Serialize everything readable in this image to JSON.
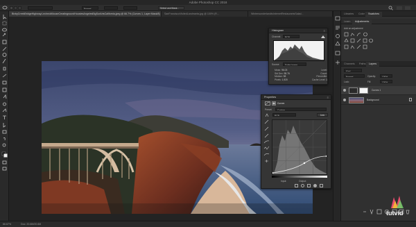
{
  "app": {
    "title": "Adobe Photoshop CC 2018"
  },
  "options_bar": {
    "mode_label": "Normal",
    "select_mask": "Select and Mask..."
  },
  "tabs": [
    {
      "label": "BixbyCreekBridgeHighway.LecheckMouseCreatingroundHoustesAngelesBigSurArtsCalifornia.jpeg @ 66.7% (Curves 1, Layer Mask/8)",
      "active": true
    },
    {
      "label": "SanFranciscoVisitedLandmarks.jpg @ 100% (R...",
      "active": false
    },
    {
      "label": "WinterwonderlandtsInternetRestaurantsSalad...",
      "active": false
    }
  ],
  "status": {
    "zoom": "66.67%",
    "doc": "Doc: 20.6M/20.6M"
  },
  "histogram": {
    "title": "Histogram",
    "channel_label": "Channel:",
    "channel_value": "RGB",
    "source_label": "Source:",
    "source_value": "Entire Image",
    "stats_left": [
      [
        "Mean:",
        "96.03"
      ],
      [
        "Std Dev:",
        "55.76"
      ],
      [
        "Median:",
        "98"
      ],
      [
        "Pixels:",
        "1,920"
      ]
    ],
    "stats_right": [
      [
        "Level:",
        ""
      ],
      [
        "Count:",
        ""
      ],
      [
        "Percentile:",
        ""
      ],
      [
        "Cache Level:",
        "1"
      ]
    ]
  },
  "properties": {
    "title": "Properties",
    "kind": "Curves",
    "preset_label": "Preset:",
    "preset_value": "Custom",
    "channel_value": "RGB",
    "auto_label": "Auto",
    "input_label": "Input:",
    "output_label": "Output:"
  },
  "right_panel": {
    "top_tabs": [
      "Libraries",
      "Color",
      "Swatches"
    ],
    "sub_tabs": [
      "Learn",
      "Adjustments"
    ],
    "add_adjustment": "Add an adjustment",
    "layer_tabs": [
      "Channels",
      "Paths",
      "Layers"
    ],
    "kind_label": "Kind",
    "blend_mode": "Normal",
    "opacity_label": "Opacity:",
    "opacity_value": "100%",
    "lock_label": "Lock:",
    "fill_label": "Fill:",
    "fill_value": "100%",
    "layers": [
      {
        "name": "Curves 1",
        "type": "adjustment",
        "active": true
      },
      {
        "name": "Background",
        "type": "image",
        "active": false
      }
    ]
  },
  "watermark": {
    "brand": "tutvid"
  },
  "colors": {
    "accent": "#2b7bd8",
    "panel": "#353535",
    "background": "#232323"
  }
}
